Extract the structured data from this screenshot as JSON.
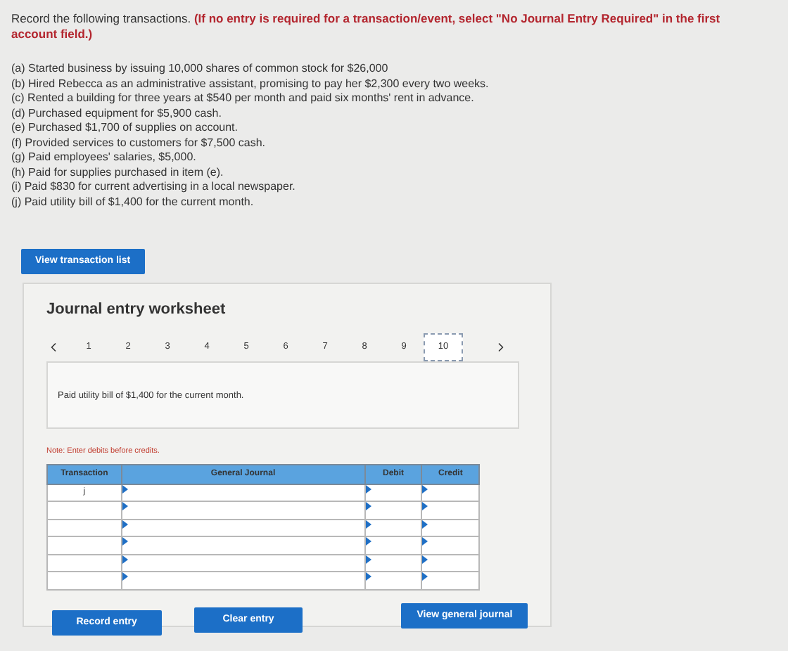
{
  "instructions": {
    "text": "Record the following transactions.",
    "emphasis": "(If no entry is required for a transaction/event, select \"No Journal Entry Required\" in the first account field.)"
  },
  "transactions": [
    "(a) Started business by issuing 10,000 shares of common stock for $26,000",
    "(b) Hired Rebecca as an administrative assistant, promising to pay her $2,300 every two weeks.",
    "(c) Rented a building for three years at $540 per month and paid six months' rent in advance.",
    "(d) Purchased equipment for $5,900 cash.",
    "(e) Purchased $1,700 of supplies on account.",
    "(f) Provided services to customers for $7,500 cash.",
    "(g) Paid employees' salaries, $5,000.",
    "(h) Paid for supplies purchased in item (e).",
    "(i) Paid $830 for current advertising in a local newspaper.",
    "(j) Paid utility bill of $1,400 for the current month."
  ],
  "view_transactions_button": "View transaction list",
  "worksheet": {
    "title": "Journal entry worksheet",
    "pages": [
      {
        "label": "1",
        "selected": false
      },
      {
        "label": "2",
        "selected": false
      },
      {
        "label": "3",
        "selected": false
      },
      {
        "label": "4",
        "selected": false
      },
      {
        "label": "5",
        "selected": false
      },
      {
        "label": "6",
        "selected": false
      },
      {
        "label": "7",
        "selected": false
      },
      {
        "label": "8",
        "selected": false
      },
      {
        "label": "9",
        "selected": false
      },
      {
        "label": "10",
        "selected": true
      }
    ],
    "description": "Paid utility bill of $1,400 for the current month.",
    "note": "Note: Enter debits before credits.",
    "table": {
      "columns": [
        "Transaction",
        "General Journal",
        "Debit",
        "Credit"
      ],
      "rows": [
        {
          "transaction": "j"
        },
        {},
        {},
        {},
        {},
        {}
      ]
    },
    "buttons": {
      "record": "Record entry",
      "clear": "Clear entry",
      "view_journal": "View general journal"
    }
  }
}
